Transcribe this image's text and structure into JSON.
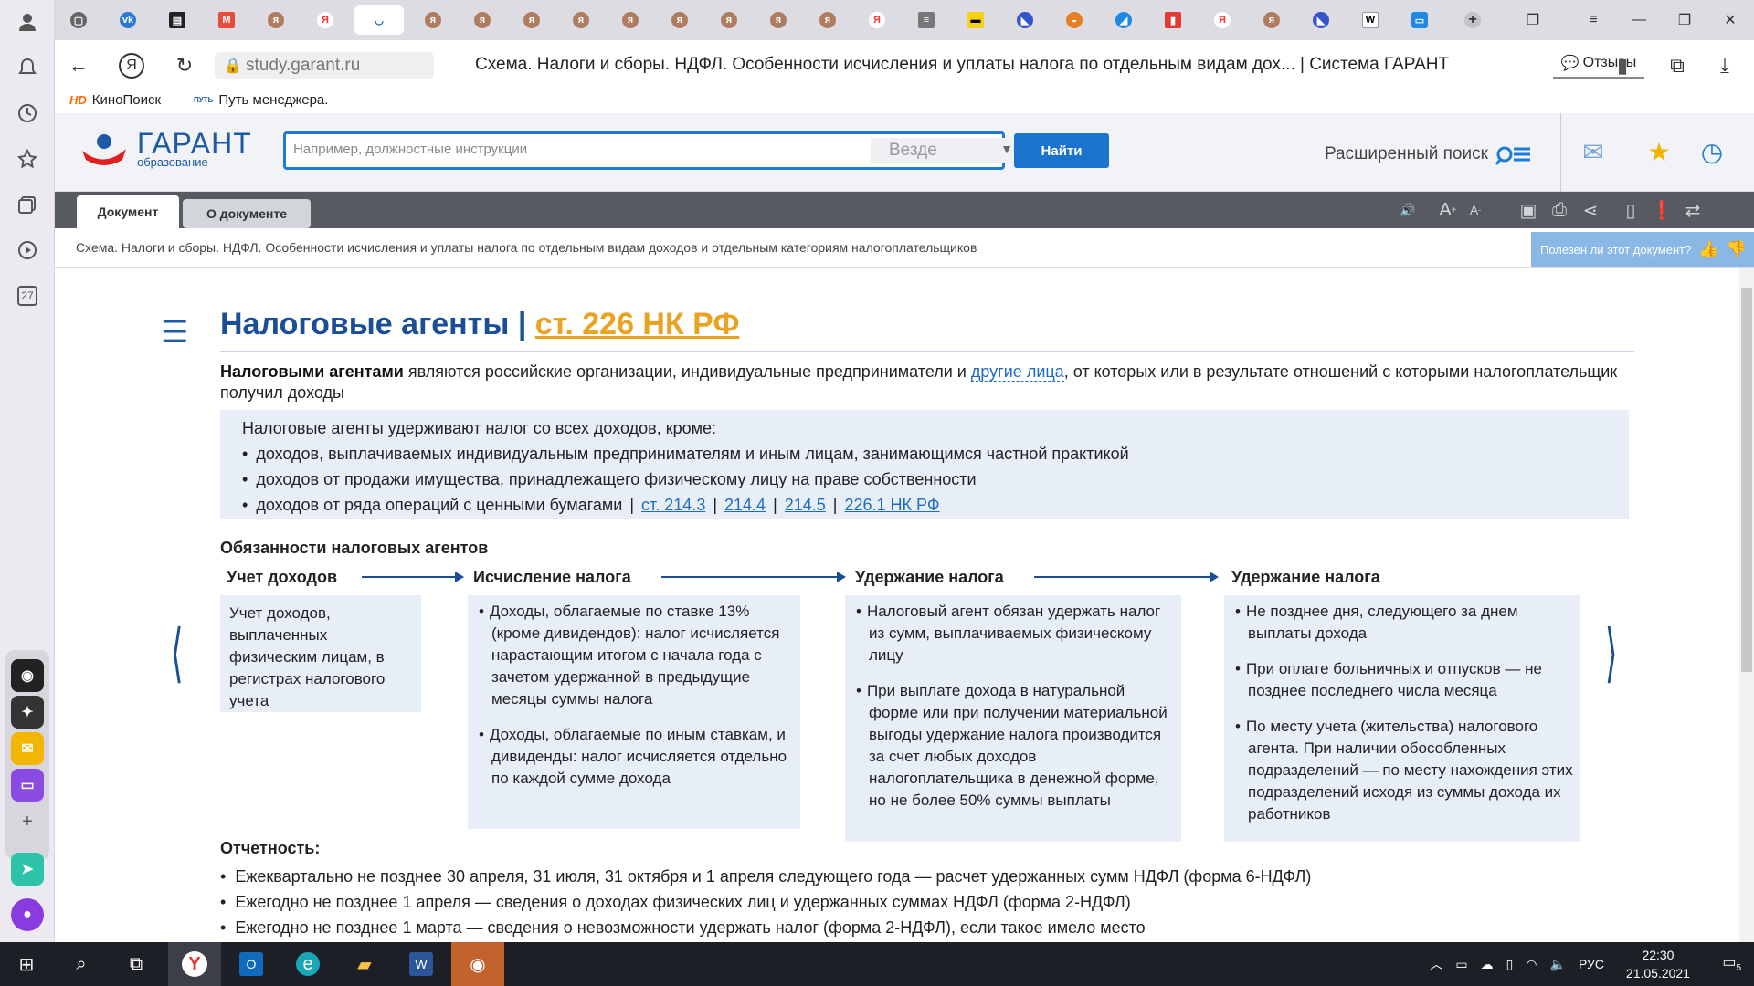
{
  "browser": {
    "url": "study.garant.ru",
    "title": "Схема. Налоги и сборы. НДФЛ. Особенности исчисления и уплаты налога по отдельным видам дох... | Система ГАРАНТ",
    "feedback_label": "Отзывы",
    "sidebar_badge": "27",
    "bookmarks": [
      {
        "label": "КиноПоиск",
        "icon": "HD"
      },
      {
        "label": "Путь менеджера.",
        "icon": "ПУТЬ"
      }
    ]
  },
  "garant": {
    "logo_title": "ГАРАНТ",
    "logo_subtitle": "образование",
    "search_placeholder": "Например, должностные инструкции",
    "search_scope": "Везде",
    "search_button": "Найти",
    "advanced_search": "Расширенный поиск"
  },
  "doc_tabs": {
    "document": "Документ",
    "about": "О документе"
  },
  "breadcrumb": "Схема. Налоги и сборы. НДФЛ. Особенности исчисления и уплаты налога по отдельным видам доходов и отдельным категориям налогоплательщиков",
  "useful_prompt": "Полезен ли этот документ?",
  "doc": {
    "heading": "Налоговые агенты",
    "heading_sep": "|",
    "heading_link": "ст. 226 НК РФ",
    "intro_bold": "Налоговыми агентами",
    "intro_text1": " являются российские организации, индивидуальные предприниматели и ",
    "intro_link": "другие лица",
    "intro_text2": ", от которых или в результате отношений с которыми налогоплательщик получил доходы",
    "exceptions_title": "Налоговые агенты удерживают налог со всех доходов, кроме:",
    "exceptions": [
      "доходов, выплачиваемых индивидуальным предпринимателям и иным лицам, занимающимся частной практикой",
      "доходов от продажи имущества, принадлежащего физическому лицу на праве собственности",
      "доходов от ряда операций с ценными бумагами"
    ],
    "exception_links": [
      "ст. 214.3",
      "214.4",
      "214.5",
      "226.1 НК РФ"
    ],
    "duties_title": "Обязанности налоговых агентов",
    "steps": [
      {
        "title": "Учет доходов",
        "items": [
          "Учет доходов, выплаченных физическим лицам, в регистрах налогового учета"
        ]
      },
      {
        "title": "Исчисление налога",
        "items": [
          "Доходы, облагаемые по ставке 13% (кроме дивидендов): налог исчисляется нарастающим итогом с начала года с зачетом удержанной в предыдущие месяцы суммы налога",
          "Доходы, облагаемые по иным ставкам, и дивиденды: налог исчисляется отдельно по каждой сумме дохода"
        ]
      },
      {
        "title": "Удержание налога",
        "items": [
          "Налоговый агент обязан удержать налог из сумм, выплачиваемых физическому лицу",
          "При выплате дохода в натуральной форме или при получении материальной выгоды удержание налога производится за счет любых доходов налогоплательщика в денежной форме, но не более 50% суммы выплаты"
        ]
      },
      {
        "title": "Удержание налога",
        "items": [
          "Не позднее дня, следующего за днем выплаты дохода",
          "При оплате больничных и отпусков — не позднее последнего числа месяца",
          "По месту учета (жительства) налогового агента. При наличии обособленных подразделений — по месту нахождения этих подразделений исходя из суммы дохода их работников"
        ]
      }
    ],
    "reports_title": "Отчетность:",
    "reports": [
      "Ежеквартально не позднее 30 апреля, 31 июля, 31 октября и 1 апреля следующего года — расчет удержанных сумм НДФЛ (форма 6-НДФЛ)",
      "Ежегодно не позднее 1 апреля — сведения о доходах физических лиц и удержанных суммах НДФЛ (форма 2-НДФЛ)",
      "Ежегодно не позднее 1 марта — сведения о невозможности удержать налог (форма 2-НДФЛ), если такое имело место"
    ]
  },
  "taskbar": {
    "lang": "РУС",
    "time": "22:30",
    "date": "21.05.2021",
    "notifications": "5"
  }
}
